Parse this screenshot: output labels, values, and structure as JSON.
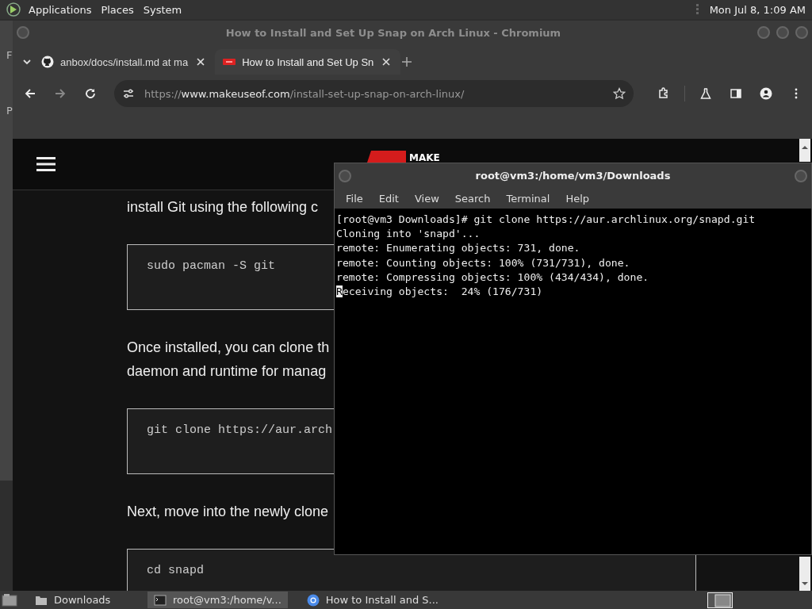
{
  "top_panel": {
    "menus": [
      "Applications",
      "Places",
      "System"
    ],
    "clock": "Mon Jul 8, 1:09 AM"
  },
  "background_window": {
    "letters": [
      "F",
      "P"
    ]
  },
  "browser": {
    "title": "How to Install and Set Up Snap on Arch Linux - Chromium",
    "tabs": [
      {
        "label": "anbox/docs/install.md at ma",
        "kind": "github",
        "selected": false
      },
      {
        "label": "How to Install and Set Up Sn",
        "kind": "site",
        "selected": true
      }
    ],
    "address": {
      "scheme": "https://",
      "host": "www.makeuseof.com",
      "path": "/install-set-up-snap-on-arch-linux/"
    },
    "page": {
      "logo": "MAKE",
      "blocks": [
        {
          "kind": "paragraph",
          "lines": [
            "install Git using the following c"
          ]
        },
        {
          "kind": "code",
          "text": "sudo pacman -S git"
        },
        {
          "kind": "paragraph",
          "lines": [
            "Once installed, you can clone th",
            "daemon and runtime for manag"
          ]
        },
        {
          "kind": "code",
          "text": "git clone https://aur.arch"
        },
        {
          "kind": "paragraph",
          "lines": [
            "Next, move into the newly clone"
          ]
        },
        {
          "kind": "code",
          "text": "cd snapd"
        }
      ]
    }
  },
  "terminal": {
    "title": "root@vm3:/home/vm3/Downloads",
    "menus": [
      "File",
      "Edit",
      "View",
      "Search",
      "Terminal",
      "Help"
    ],
    "lines": [
      {
        "text": "[root@vm3 Downloads]# git clone https://aur.archlinux.org/snapd.git",
        "cursor": false
      },
      {
        "text": "Cloning into 'snapd'...",
        "cursor": false
      },
      {
        "text": "remote: Enumerating objects: 731, done.",
        "cursor": false
      },
      {
        "text": "remote: Counting objects: 100% (731/731), done.",
        "cursor": false
      },
      {
        "text": "remote: Compressing objects: 100% (434/434), done.",
        "cursor": false
      },
      {
        "text": "Receiving objects:  24% (176/731)",
        "cursor": true
      }
    ]
  },
  "taskbar": {
    "items": [
      {
        "label": "Downloads",
        "kind": "folder",
        "selected": false
      },
      {
        "label": "root@vm3:/home/v...",
        "kind": "terminal",
        "selected": true
      },
      {
        "label": "How to Install and S...",
        "kind": "browser",
        "selected": false
      }
    ]
  }
}
